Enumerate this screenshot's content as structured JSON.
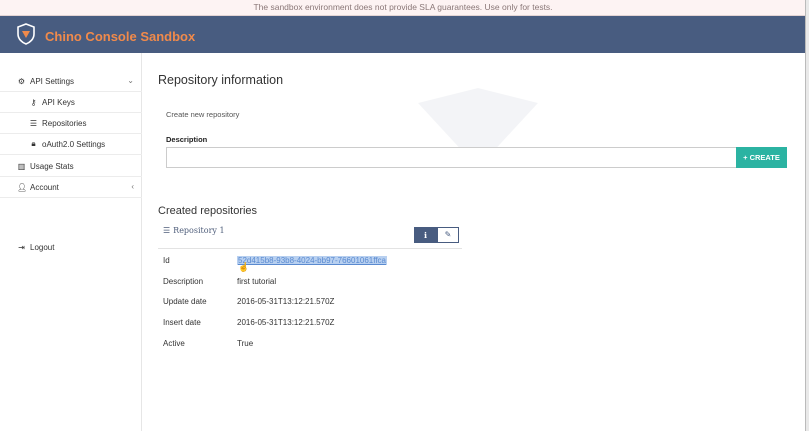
{
  "banner": {
    "text": "The sandbox environment does not provide SLA guarantees. Use only for tests."
  },
  "navbar": {
    "title": "Chino Console Sandbox",
    "logo_icon": "shield-logo-icon"
  },
  "sidebar": {
    "items": [
      {
        "label": "API Settings",
        "icon": "gears-icon",
        "expanded": true
      },
      {
        "label": "API Keys",
        "icon": "key-icon"
      },
      {
        "label": "Repositories",
        "icon": "database-icon"
      },
      {
        "label": "oAuth2.0 Settings",
        "icon": "lock-icon"
      },
      {
        "label": "Usage Stats",
        "icon": "bar-chart-icon"
      },
      {
        "label": "Account",
        "icon": "user-icon",
        "expanded": false
      },
      {
        "label": "Logout",
        "icon": "sign-out-icon"
      }
    ]
  },
  "main": {
    "title": "Repository information",
    "create_hint": "Create new repository",
    "description_label": "Description",
    "description_value": "",
    "create_button": "+ CREATE",
    "created_title": "Created repositories",
    "repo": {
      "name": "Repository 1",
      "rows": [
        {
          "label": "Id",
          "value": "52d415b8-93b8-4024-bb97-76601061ffca"
        },
        {
          "label": "Description",
          "value": "first tutorial"
        },
        {
          "label": "Update date",
          "value": "2016-05-31T13:12:21.570Z"
        },
        {
          "label": "Insert date",
          "value": "2016-05-31T13:12:21.570Z"
        },
        {
          "label": "Active",
          "value": "True"
        }
      ]
    }
  },
  "colors": {
    "navbar": "#485c80",
    "brand": "#f08a4b",
    "create": "#2bb3a2",
    "link": "#5a8ad0"
  }
}
